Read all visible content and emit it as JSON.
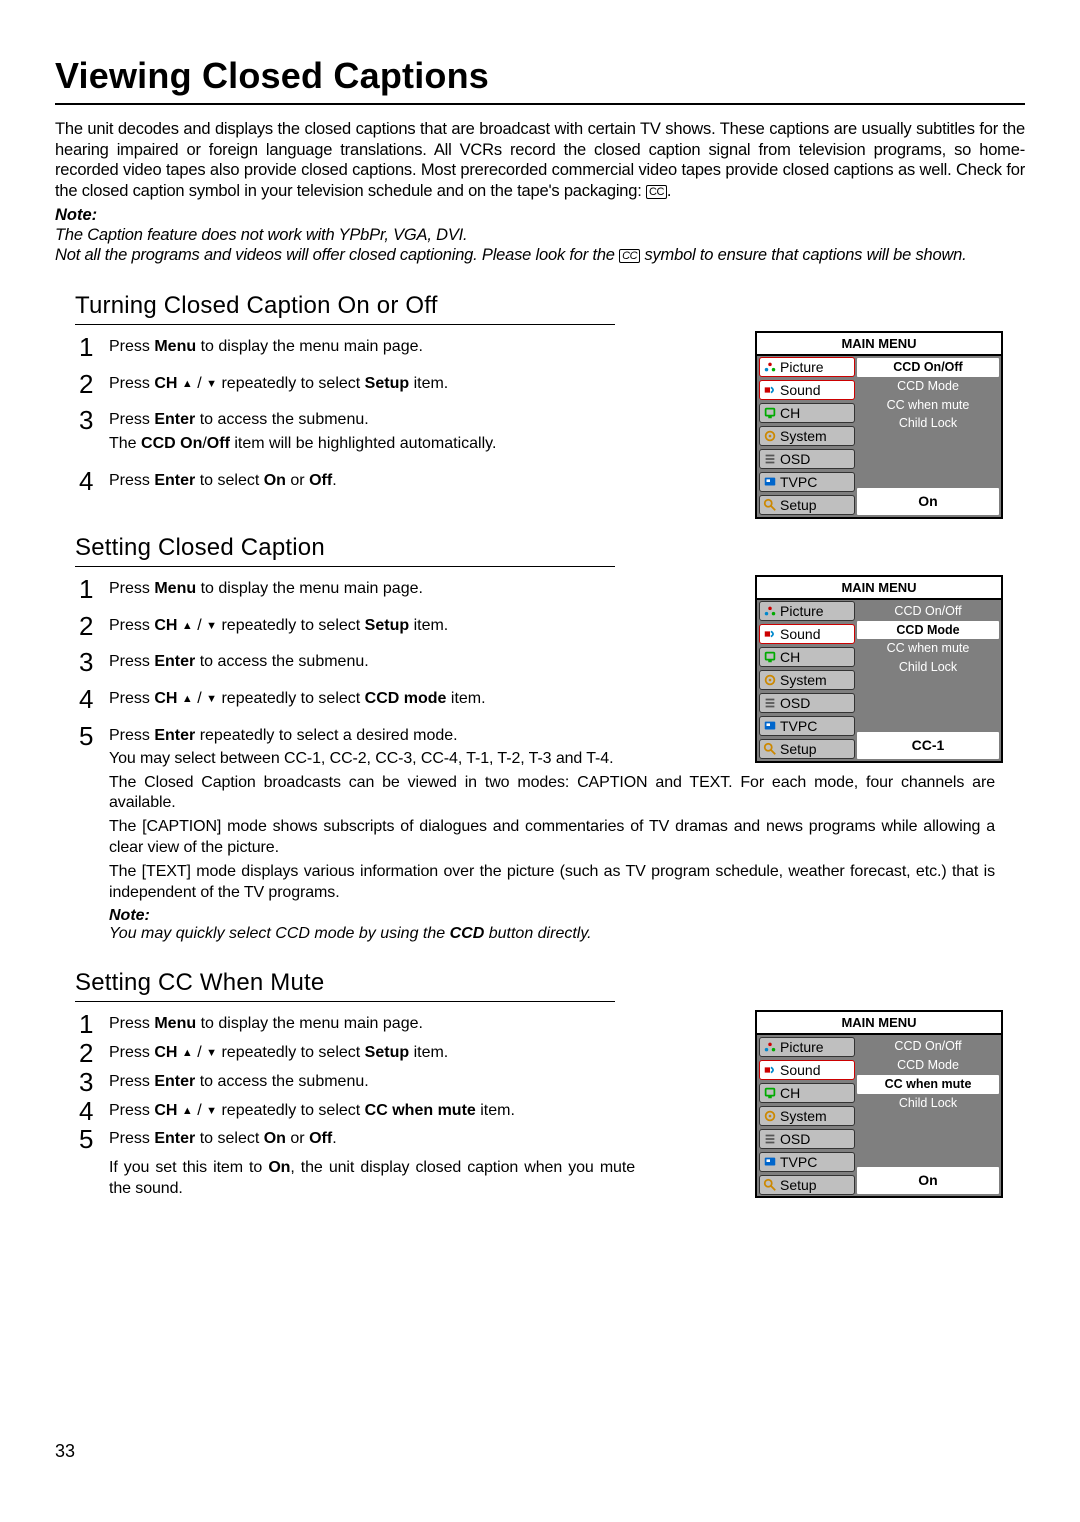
{
  "page_title": "Viewing Closed Captions",
  "intro": "The unit decodes and displays the closed captions that are broadcast with certain TV shows. These captions are usually subtitles for the hearing impaired or foreign language translations. All VCRs record the closed caption signal from television programs, so home-recorded video tapes also provide closed captions. Most prerecorded commercial video tapes provide closed captions as well. Check for the closed caption symbol in your television schedule and on the tape's packaging: ",
  "cc_symbol": "CC",
  "note_label": "Note:",
  "note_line1": "The Caption feature does not work with YPbPr, VGA, DVI.",
  "note_line2_a": "Not all the programs and videos will offer closed captioning. Please look for the ",
  "note_line2_b": " symbol to ensure that captions will be shown.",
  "sec1_title": "Turning Closed Caption On or Off",
  "sec1_steps": {
    "s1": [
      "Press  ",
      "Menu",
      " to display the menu main page."
    ],
    "s2": [
      "Press ",
      "CH",
      " ▲ / ▼  repeatedly to select ",
      "Setup",
      " item."
    ],
    "s3_a": [
      "Press ",
      "Enter",
      " to access the submenu."
    ],
    "s3_b": [
      "The ",
      "CCD On",
      "/",
      "Off",
      "  item will be highlighted automatically."
    ],
    "s4": [
      "Press ",
      "Enter",
      " to select ",
      "On",
      " or ",
      "Off",
      "."
    ]
  },
  "sec2_title": "Setting Closed Caption",
  "sec2_steps": {
    "s1": [
      "Press  ",
      "Menu",
      " to display the menu main page."
    ],
    "s2": [
      "Press ",
      "CH",
      " ▲ / ▼  repeatedly to select ",
      "Setup",
      " item."
    ],
    "s3": [
      "Press ",
      "Enter",
      " to access the submenu."
    ],
    "s4": [
      "Press ",
      "CH",
      " ▲ / ▼  repeatedly to select ",
      "CCD mode",
      " item."
    ],
    "s5": [
      "Press ",
      "Enter",
      " repeatedly to select a desired mode."
    ]
  },
  "sec2_follow": {
    "p1": "You may select between CC-1, CC-2, CC-3, CC-4, T-1, T-2, T-3 and  T-4.",
    "p2": "The Closed Caption broadcasts can be viewed in two modes: CAPTION and TEXT. For each mode, four channels are available.",
    "p3": "The [CAPTION] mode shows subscripts of dialogues and commentaries of TV dramas and news programs while allowing a clear view of the picture.",
    "p4": "The [TEXT] mode displays various information over the picture (such as TV program schedule, weather forecast, etc.) that is independent of the TV programs."
  },
  "sec2_note_label": "Note:",
  "sec2_note": [
    "You may quickly select CCD mode by using the ",
    "CCD",
    " button directly."
  ],
  "sec3_title": "Setting CC When Mute",
  "sec3_steps": {
    "s1": [
      "Press  ",
      "Menu",
      " to display the menu main page."
    ],
    "s2": [
      "Press ",
      "CH",
      " ▲ / ▼  repeatedly to select ",
      "Setup",
      " item."
    ],
    "s3": [
      "Press ",
      "Enter",
      " to access the submenu."
    ],
    "s4": [
      "Press ",
      "CH",
      " ▲ / ▼  repeatedly to select ",
      "CC when mute",
      " item."
    ],
    "s5": [
      "Press ",
      "Enter",
      " to select ",
      "On",
      " or ",
      "Off",
      "."
    ]
  },
  "sec3_follow": [
    "If you set this item to ",
    "On",
    ", the unit display closed caption when you mute the sound."
  ],
  "menu": {
    "header": "MAIN MENU",
    "left": [
      "Picture",
      "Sound",
      "CH",
      "System",
      "OSD",
      "TVPC",
      "Setup"
    ],
    "right": [
      "CCD On/Off",
      "CCD Mode",
      "CC when mute",
      "Child Lock"
    ]
  },
  "menu1": {
    "selected_right": 0,
    "bottom": "On",
    "left_selected": [
      0,
      1
    ]
  },
  "menu2": {
    "selected_right": 1,
    "bottom": "CC-1",
    "left_selected": [
      1
    ]
  },
  "menu3": {
    "selected_right": 2,
    "bottom": "On",
    "left_selected": [
      1
    ]
  },
  "page_number": "33"
}
